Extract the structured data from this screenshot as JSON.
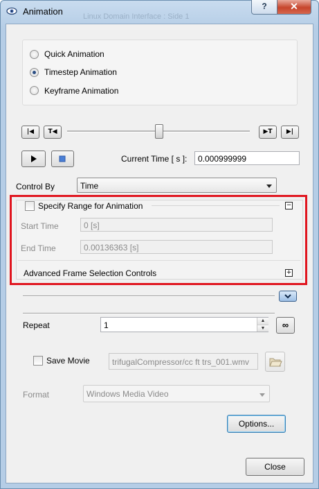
{
  "window": {
    "title": "Animation",
    "help_label": "?",
    "close_label": "✕",
    "background_text": "Linux   Domain Interface : Side 1"
  },
  "mode": {
    "options": [
      "Quick Animation",
      "Timestep Animation",
      "Keyframe Animation"
    ],
    "selected": "Timestep Animation"
  },
  "playback": {
    "current_time_label": "Current Time [ s ]:",
    "current_time_value": "0.000999999",
    "slider_level": 0.5
  },
  "control_by": {
    "label": "Control By",
    "value": "Time"
  },
  "range": {
    "checkbox_label": "Specify Range for Animation",
    "collapse_glyph": "⊟",
    "start_label": "Start Time",
    "start_value": "0 [s]",
    "end_label": "End Time",
    "end_value": "0.00136363 [s]",
    "advanced_label": "Advanced Frame Selection Controls",
    "expand_glyph": "⊞",
    "highlight_color": "#e0141e"
  },
  "repeat": {
    "label": "Repeat",
    "value": "1",
    "loop_icon": "∞"
  },
  "movie": {
    "save_label": "Save Movie",
    "path_value": "trifugalCompressor/cc ft trs_001.wmv",
    "format_label": "Format",
    "format_value": "Windows Media Video",
    "options_label": "Options..."
  },
  "footer": {
    "close_label": "Close"
  }
}
